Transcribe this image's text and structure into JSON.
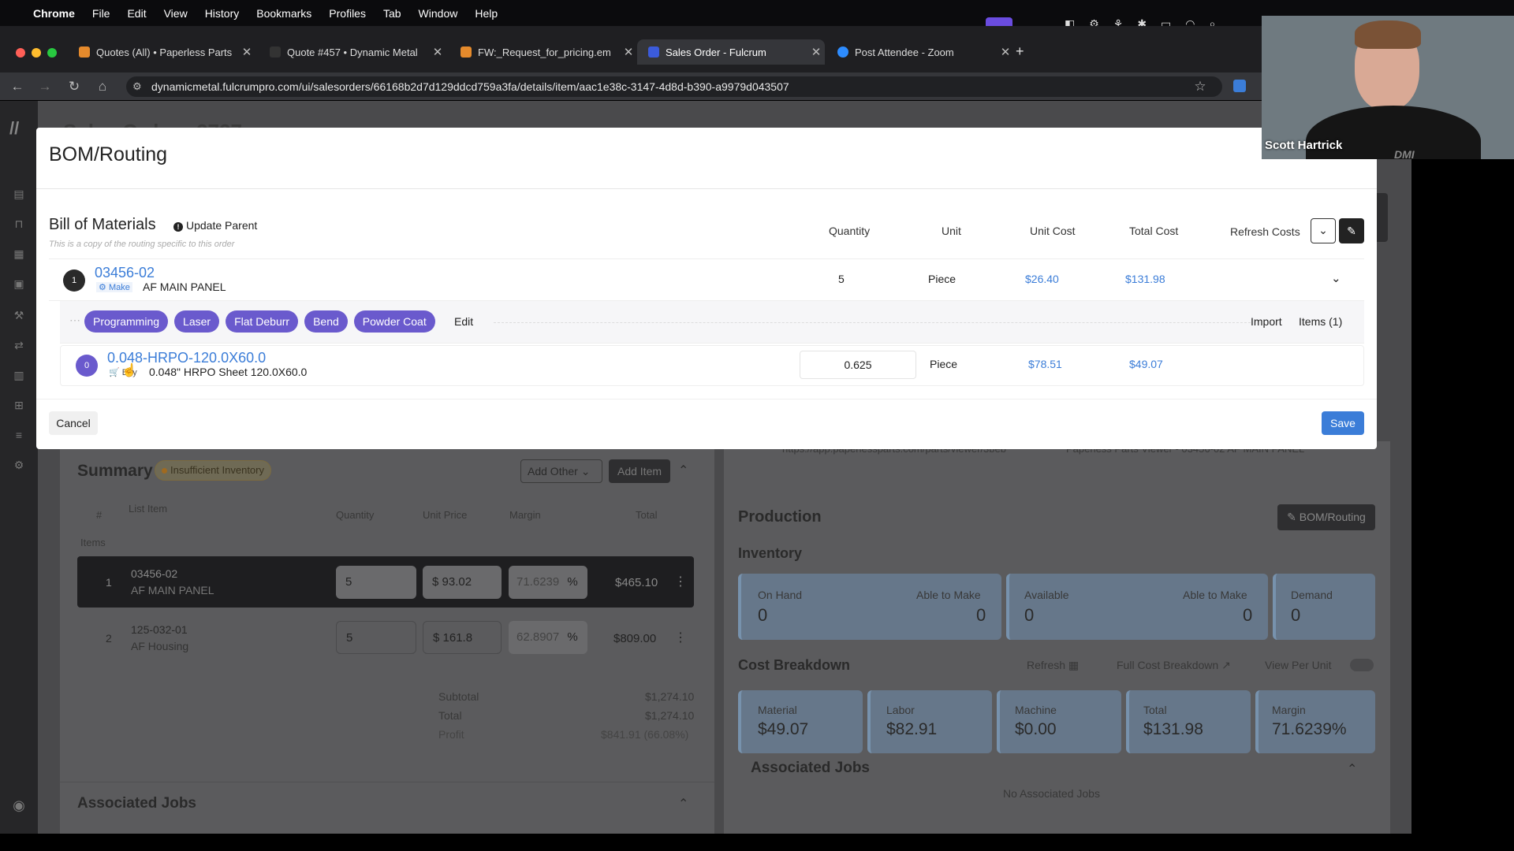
{
  "menubar": {
    "items": [
      "Chrome",
      "File",
      "Edit",
      "View",
      "History",
      "Bookmarks",
      "Profiles",
      "Tab",
      "Window",
      "Help"
    ]
  },
  "tabs": [
    {
      "title": "Quotes (All) • Paperless Parts",
      "color": "#e58a2c"
    },
    {
      "title": "Quote #457 • Dynamic Metal",
      "color": "#333"
    },
    {
      "title": "FW:_Request_for_pricing.em",
      "color": "#e58a2c"
    },
    {
      "title": "Sales Order - Fulcrum",
      "color": "#3b5bdb"
    },
    {
      "title": "Post Attendee - Zoom",
      "color": "#2d8cff"
    }
  ],
  "url": "dynamicmetal.fulcrumpro.com/ui/salesorders/66168b2d7d129ddcd759a3fa/details/item/aac1e38c-3147-4d8d-b390-a9979d043507",
  "bg": {
    "page_title": "Sales Order - 2727",
    "summary": {
      "title": "Summary",
      "badge": "Insufficient Inventory",
      "add_other": "Add Other",
      "add_item": "Add Item",
      "cols": [
        "#",
        "List Item",
        "Quantity",
        "Unit Price",
        "Margin",
        "Total"
      ],
      "items_label": "Items",
      "rows": [
        {
          "num": "1",
          "part": "03456-02",
          "desc": "AF MAIN PANEL",
          "qty": "5",
          "price": "$ 93.02",
          "margin": "71.6239",
          "pct": "%",
          "total": "$465.10"
        },
        {
          "num": "2",
          "part": "125-032-01",
          "desc": "AF Housing",
          "qty": "5",
          "price": "$ 161.8",
          "margin": "62.8907",
          "pct": "%",
          "total": "$809.00"
        }
      ],
      "subtotal_label": "Subtotal",
      "subtotal": "$1,274.10",
      "total_label": "Total",
      "total": "$1,274.10",
      "profit_label": "Profit",
      "profit": "$841.91 (66.08%)"
    },
    "assoc_jobs": "Associated Jobs",
    "right": {
      "link_text": "https://app.paperlessparts.com/parts/viewer/3beb",
      "viewer_text": "Paperless Parts Viewer - 03456-02 AF MAIN PANEL",
      "production": "Production",
      "bom_btn": "BOM/Routing",
      "inventory": "Inventory",
      "inv_cards": [
        {
          "l1": "On Hand",
          "v1": "0",
          "l2": "Able to Make",
          "v2": "0"
        },
        {
          "l1": "Available",
          "v1": "0",
          "l2": "Able to Make",
          "v2": "0"
        },
        {
          "l1": "Demand",
          "v1": "0"
        }
      ],
      "cost_breakdown": "Cost Breakdown",
      "refresh": "Refresh",
      "full_cost": "Full Cost Breakdown",
      "view_per_unit": "View Per Unit",
      "cost_cards": [
        {
          "label": "Material",
          "value": "$49.07"
        },
        {
          "label": "Labor",
          "value": "$82.91"
        },
        {
          "label": "Machine",
          "value": "$0.00"
        },
        {
          "label": "Total",
          "value": "$131.98"
        },
        {
          "label": "Margin",
          "value": "71.6239%"
        }
      ],
      "assoc_jobs": "Associated Jobs",
      "no_jobs": "No Associated Jobs"
    }
  },
  "modal": {
    "title": "BOM/Routing",
    "bom_title": "Bill of Materials",
    "update_parent": "Update Parent",
    "subtitle": "This is a copy of the routing specific to this order",
    "cols": {
      "quantity": "Quantity",
      "unit": "Unit",
      "unit_cost": "Unit Cost",
      "total_cost": "Total Cost"
    },
    "refresh_costs": "Refresh Costs",
    "parent": {
      "index": "1",
      "part": "03456-02",
      "type": "Make",
      "desc": "AF MAIN PANEL",
      "qty": "5",
      "unit": "Piece",
      "unit_cost": "$26.40",
      "total_cost": "$131.98"
    },
    "ops": [
      "Programming",
      "Laser",
      "Flat Deburr",
      "Bend",
      "Powder Coat"
    ],
    "edit": "Edit",
    "import": "Import",
    "items": "Items (1)",
    "child": {
      "index": "0",
      "part": "0.048-HRPO-120.0X60.0",
      "type": "Buy",
      "desc": "0.048\" HRPO Sheet 120.0X60.0",
      "qty": "0.625",
      "unit": "Piece",
      "unit_cost": "$78.51",
      "total_cost": "$49.07"
    },
    "cancel": "Cancel",
    "save": "Save"
  },
  "zoom": {
    "name": "Scott Hartrick",
    "shirt": "DMI"
  }
}
